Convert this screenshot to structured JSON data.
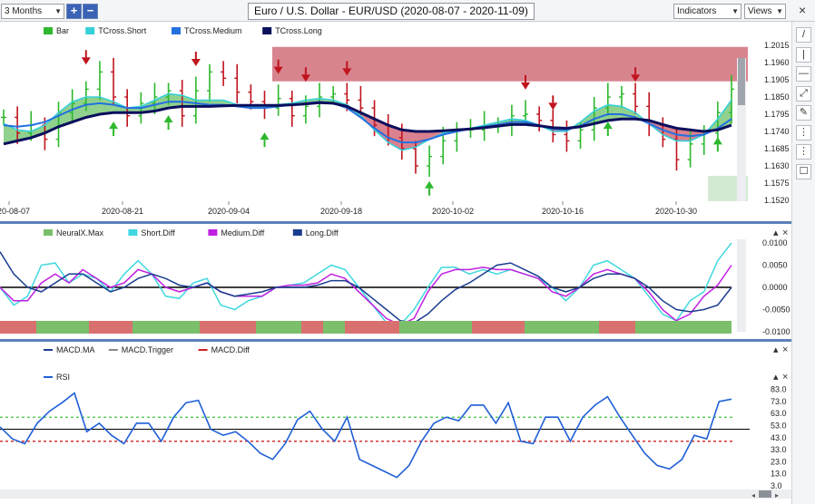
{
  "toolbar": {
    "period": "3 Months",
    "zoom_in": "+",
    "zoom_out": "−",
    "title": "Euro / U.S. Dollar - EUR/USD (2020-08-07 - 2020-11-09)",
    "indicators": "Indicators",
    "views": "Views",
    "close": "×"
  },
  "tools": [
    "/",
    "|",
    "—",
    "⤢",
    "✎",
    "⋮",
    "⋮",
    "☐"
  ],
  "colors": {
    "up_bar": "#2db82d",
    "down_bar": "#c0141e",
    "tcross_short": "#38d0d8",
    "tcross_medium": "#2370e0",
    "tcross_long": "#0a0f5c",
    "cloud_green": "#7cc97a",
    "cloud_red": "#d46a7a",
    "resistance_zone": "#c8505e",
    "short_diff": "#40d8e0",
    "medium_diff": "#c020e0",
    "long_diff": "#1a3d8f",
    "rsi": "#1f5fd6",
    "overbought_line": "#42c442",
    "oversold_line": "#d02020",
    "neural_green": "#7bbf6a",
    "neural_red": "#d97070"
  },
  "price_panel": {
    "legend": [
      "Bar",
      "TCross.Short",
      "TCross.Medium",
      "TCross.Long"
    ],
    "price_ticks": [
      "1.2015",
      "1.1960",
      "1.1905",
      "1.1850",
      "1.1795",
      "1.1740",
      "1.1685",
      "1.1630",
      "1.1575",
      "1.1520"
    ],
    "date_ticks": [
      "2020-08-07",
      "2020-08-21",
      "2020-09-04",
      "2020-09-18",
      "2020-10-02",
      "2020-10-16",
      "2020-10-30"
    ]
  },
  "neural_panel": {
    "legend": [
      "NeuralX.Max",
      "Short.Diff",
      "Medium.Diff",
      "Long.Diff"
    ],
    "ticks": [
      "0.0100",
      "0.0050",
      "0.0000",
      "-0.0050",
      "-0.0100"
    ]
  },
  "macd_panel": {
    "legend": [
      "MACD.MA",
      "MACD.Trigger",
      "MACD.Diff"
    ]
  },
  "rsi_panel": {
    "legend": [
      "RSI"
    ],
    "ticks": [
      "83.0",
      "73.0",
      "63.0",
      "53.0",
      "43.0",
      "33.0",
      "23.0",
      "13.0",
      "3.0"
    ]
  },
  "chart_data": [
    {
      "type": "line",
      "title": "Euro / U.S. Dollar - EUR/USD (2020-08-07 - 2020-11-09)",
      "series": [
        {
          "name": "Bar",
          "close": [
            1.1785,
            1.1735,
            1.176,
            1.1715,
            1.18,
            1.183,
            1.1875,
            1.193,
            1.185,
            1.179,
            1.183,
            1.185,
            1.187,
            1.179,
            1.187,
            1.193,
            1.191,
            1.1865,
            1.1835,
            1.1815,
            1.1845,
            1.179,
            1.182,
            1.185,
            1.186,
            1.184,
            1.1815,
            1.176,
            1.172,
            1.1685,
            1.163,
            1.166,
            1.171,
            1.1745,
            1.1745,
            1.176,
            1.176,
            1.179,
            1.1795,
            1.1775,
            1.173,
            1.171,
            1.1745,
            1.1815,
            1.185,
            1.186,
            1.182,
            1.176,
            1.1715,
            1.165,
            1.17,
            1.1735,
            1.18,
            1.1875
          ]
        },
        {
          "name": "TCross.Short",
          "values": [
            1.1765,
            1.1745,
            1.174,
            1.176,
            1.18,
            1.1835,
            1.185,
            1.185,
            1.1835,
            1.1815,
            1.182,
            1.184,
            1.186,
            1.1855,
            1.184,
            1.184,
            1.184,
            1.1825,
            1.182,
            1.182,
            1.1825,
            1.183,
            1.184,
            1.1845,
            1.184,
            1.1825,
            1.179,
            1.1745,
            1.1705,
            1.168,
            1.169,
            1.1715,
            1.1735,
            1.1745,
            1.175,
            1.176,
            1.177,
            1.178,
            1.1775,
            1.176,
            1.174,
            1.174,
            1.177,
            1.1805,
            1.1825,
            1.182,
            1.18,
            1.1765,
            1.173,
            1.171,
            1.171,
            1.173,
            1.178,
            1.184
          ]
        },
        {
          "name": "TCross.Medium",
          "values": [
            1.176,
            1.1755,
            1.176,
            1.177,
            1.179,
            1.181,
            1.1825,
            1.183,
            1.1825,
            1.1815,
            1.1815,
            1.1825,
            1.1835,
            1.1835,
            1.183,
            1.1825,
            1.1825,
            1.182,
            1.1815,
            1.1815,
            1.182,
            1.1825,
            1.183,
            1.1835,
            1.183,
            1.1815,
            1.1785,
            1.175,
            1.172,
            1.1705,
            1.1705,
            1.1715,
            1.173,
            1.174,
            1.1748,
            1.1755,
            1.1762,
            1.177,
            1.177,
            1.176,
            1.1748,
            1.1745,
            1.1758,
            1.178,
            1.1795,
            1.1795,
            1.1785,
            1.1765,
            1.1745,
            1.173,
            1.1725,
            1.173,
            1.175,
            1.178
          ]
        },
        {
          "name": "TCross.Long",
          "values": [
            1.17,
            1.171,
            1.172,
            1.1735,
            1.1755,
            1.177,
            1.1785,
            1.1795,
            1.18,
            1.18,
            1.18,
            1.1805,
            1.1815,
            1.182,
            1.182,
            1.182,
            1.1822,
            1.1823,
            1.1823,
            1.1823,
            1.1823,
            1.1825,
            1.1828,
            1.1832,
            1.183,
            1.182,
            1.18,
            1.178,
            1.176,
            1.1745,
            1.174,
            1.174,
            1.1742,
            1.1745,
            1.1748,
            1.1752,
            1.1757,
            1.1762,
            1.1762,
            1.1758,
            1.1752,
            1.175,
            1.1755,
            1.1765,
            1.1775,
            1.178,
            1.178,
            1.1775,
            1.1762,
            1.175,
            1.1745,
            1.174,
            1.1745,
            1.176
          ]
        }
      ],
      "ylim": [
        1.152,
        1.2015
      ],
      "resistance_zone": [
        1.19,
        1.201
      ]
    },
    {
      "type": "line",
      "series": [
        {
          "name": "Short.Diff",
          "values": [
            0.0,
            -0.004,
            -0.002,
            0.005,
            0.0055,
            0.001,
            0.003,
            0.002,
            -0.001,
            0.003,
            0.006,
            0.003,
            -0.002,
            -0.0025,
            0.001,
            0.002,
            -0.004,
            -0.005,
            -0.003,
            -0.002,
            0.0,
            0.0005,
            0.001,
            0.003,
            0.005,
            0.004,
            0.0,
            -0.004,
            -0.008,
            -0.0085,
            -0.005,
            0.0,
            0.0045,
            0.0045,
            0.003,
            0.004,
            0.003,
            0.004,
            0.003,
            0.002,
            0.0,
            -0.003,
            0.0,
            0.005,
            0.006,
            0.004,
            0.002,
            -0.002,
            -0.006,
            -0.0075,
            -0.003,
            -0.001,
            0.006,
            0.01
          ]
        },
        {
          "name": "Medium.Diff",
          "values": [
            0.0,
            -0.003,
            -0.003,
            0.001,
            0.003,
            0.001,
            0.004,
            0.002,
            0.0,
            0.001,
            0.004,
            0.003,
            0.0,
            -0.001,
            0.0,
            0.001,
            -0.001,
            -0.002,
            -0.002,
            -0.002,
            0.0,
            0.0005,
            0.0005,
            0.001,
            0.003,
            0.002,
            -0.001,
            -0.004,
            -0.007,
            -0.0085,
            -0.007,
            -0.001,
            0.003,
            0.004,
            0.004,
            0.0045,
            0.004,
            0.004,
            0.003,
            0.002,
            -0.001,
            -0.002,
            0.0,
            0.003,
            0.004,
            0.003,
            0.002,
            -0.001,
            -0.005,
            -0.0075,
            -0.006,
            -0.002,
            0.0005,
            0.005
          ]
        },
        {
          "name": "Long.Diff",
          "values": [
            0.008,
            0.003,
            0.0,
            -0.001,
            0.001,
            0.003,
            0.003,
            0.001,
            -0.001,
            0.0,
            0.002,
            0.003,
            0.002,
            0.0005,
            0.0,
            0.001,
            -0.001,
            -0.002,
            -0.0015,
            -0.001,
            0.0,
            0.0,
            0.0,
            0.0005,
            0.0015,
            0.0015,
            0.0,
            -0.0025,
            -0.005,
            -0.0075,
            -0.008,
            -0.006,
            -0.003,
            -0.0005,
            0.001,
            0.003,
            0.005,
            0.0055,
            0.004,
            0.0025,
            0.0,
            -0.001,
            0.0,
            0.002,
            0.003,
            0.003,
            0.002,
            0.0,
            -0.003,
            -0.005,
            -0.0055,
            -0.005,
            -0.004,
            0.0
          ]
        }
      ],
      "ylim": [
        -0.01,
        0.01
      ],
      "neural_segments": [
        "red",
        "green",
        "red",
        "green",
        "red",
        "green",
        "red",
        "green",
        "red",
        "green",
        "red",
        "green",
        "red",
        "green"
      ]
    },
    {
      "type": "line",
      "series": [
        {
          "name": "RSI",
          "values": [
            52,
            42,
            38,
            55,
            65,
            72,
            80,
            48,
            55,
            45,
            38,
            55,
            55,
            40,
            60,
            72,
            74,
            50,
            45,
            48,
            40,
            30,
            25,
            38,
            58,
            65,
            50,
            40,
            60,
            25,
            20,
            15,
            10,
            20,
            40,
            55,
            60,
            57,
            70,
            70,
            55,
            72,
            40,
            38,
            60,
            60,
            40,
            60,
            70,
            77,
            60,
            45,
            30,
            20,
            17,
            25,
            45,
            42,
            73,
            75
          ]
        }
      ],
      "ylim": [
        3,
        85
      ],
      "overbought": 60,
      "oversold": 40
    }
  ]
}
